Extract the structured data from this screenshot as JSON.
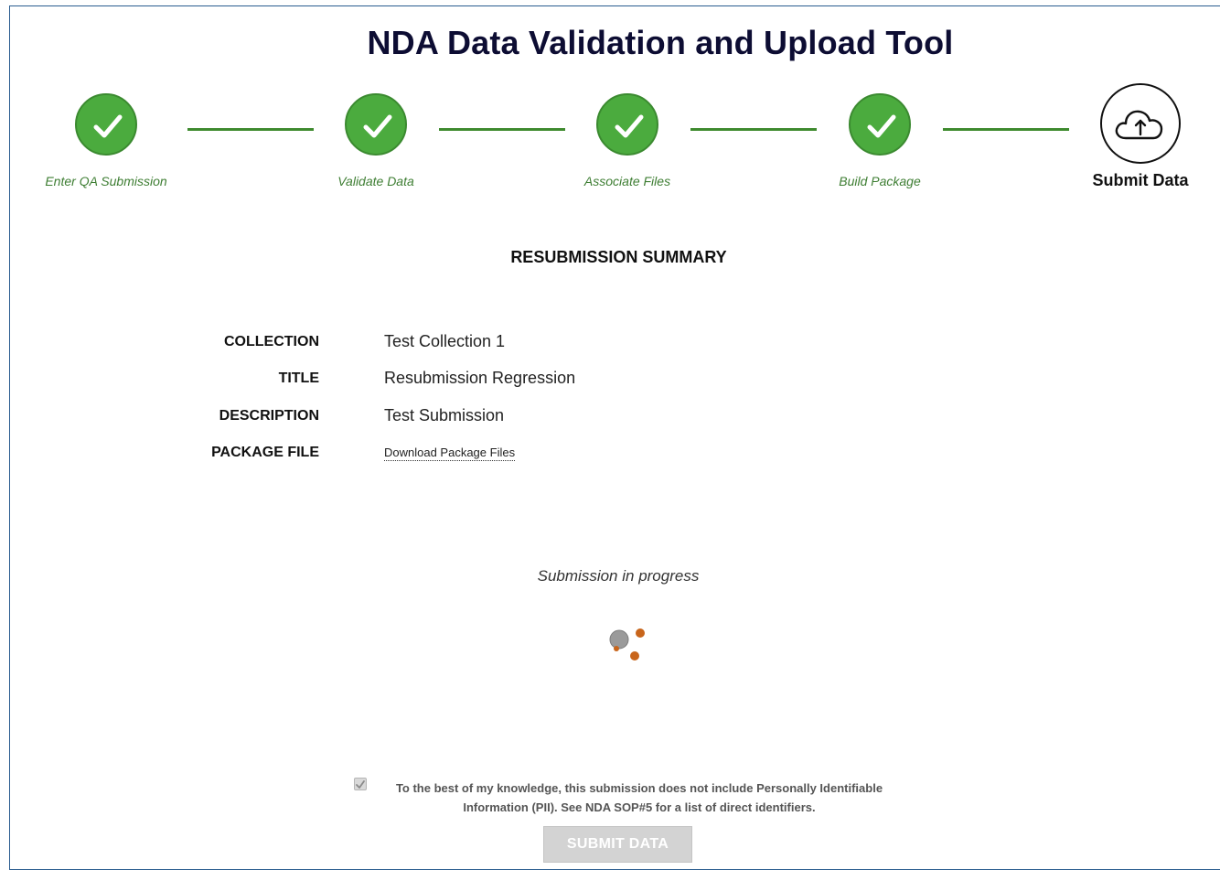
{
  "page": {
    "title": "NDA Data Validation and Upload Tool"
  },
  "steps": [
    {
      "label": "Enter QA Submission",
      "status": "complete",
      "icon": "check-icon"
    },
    {
      "label": "Validate Data",
      "status": "complete",
      "icon": "check-icon"
    },
    {
      "label": "Associate Files",
      "status": "complete",
      "icon": "check-icon"
    },
    {
      "label": "Build Package",
      "status": "complete",
      "icon": "check-icon"
    },
    {
      "label": "Submit Data",
      "status": "current",
      "icon": "cloud-upload-icon"
    }
  ],
  "summary": {
    "heading": "RESUBMISSION SUMMARY",
    "rows": [
      {
        "label": "COLLECTION",
        "value": "Test Collection 1"
      },
      {
        "label": "TITLE",
        "value": "Resubmission Regression"
      },
      {
        "label": "DESCRIPTION",
        "value": "Test Submission"
      },
      {
        "label": "PACKAGE FILE",
        "value": "Download Package Files"
      }
    ]
  },
  "progress": {
    "text": "Submission in progress",
    "icon": "loading-spinner-icon"
  },
  "pii": {
    "checked": true,
    "line1": "To the best of my knowledge, this submission does not include Personally Identifiable",
    "line2": "Information (PII). See NDA SOP#5 for a list of direct identifiers."
  },
  "submit": {
    "label": "SUBMIT DATA",
    "disabled": true
  },
  "colors": {
    "step_complete": "#4bab3e",
    "step_label": "#3e7e33",
    "connector": "#3e8a2e",
    "spinner_gray": "#9a9a9a",
    "spinner_orange": "#c8651b"
  }
}
